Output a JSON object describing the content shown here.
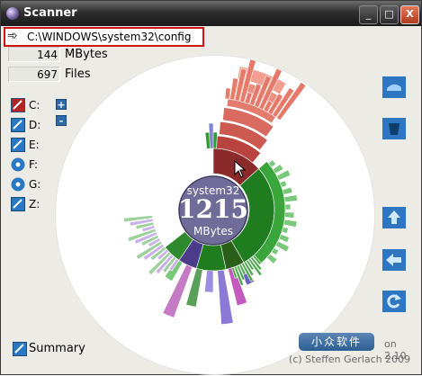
{
  "window": {
    "title": "Scanner"
  },
  "titlebar": {
    "min_label": "_",
    "max_label": "□",
    "close_label": "X"
  },
  "path": {
    "value": "C:\\WINDOWS\\system32\\config"
  },
  "stats": [
    {
      "value": "144",
      "label": "MBytes"
    },
    {
      "value": "697",
      "label": "Files"
    }
  ],
  "drives": [
    {
      "label": "C:",
      "type": "hard-disk-selected"
    },
    {
      "label": "D:",
      "type": "hard-disk"
    },
    {
      "label": "E:",
      "type": "hard-disk"
    },
    {
      "label": "F:",
      "type": "cd-drive"
    },
    {
      "label": "G:",
      "type": "cd-drive"
    },
    {
      "label": "Z:",
      "type": "network-drive"
    }
  ],
  "zoom": {
    "plus": "+",
    "minus": "-"
  },
  "center": {
    "name": "system32",
    "size": "1215",
    "unit": "MBytes"
  },
  "summary": {
    "label": "Summary"
  },
  "footer": {
    "version": "on 2.10",
    "copyright": "(c) Steffen Gerlach 2009",
    "watermark": "小众软件"
  },
  "colors": {
    "accent": "#1a7a1a",
    "selected": "#c9534a",
    "center": "#6f6c99"
  }
}
